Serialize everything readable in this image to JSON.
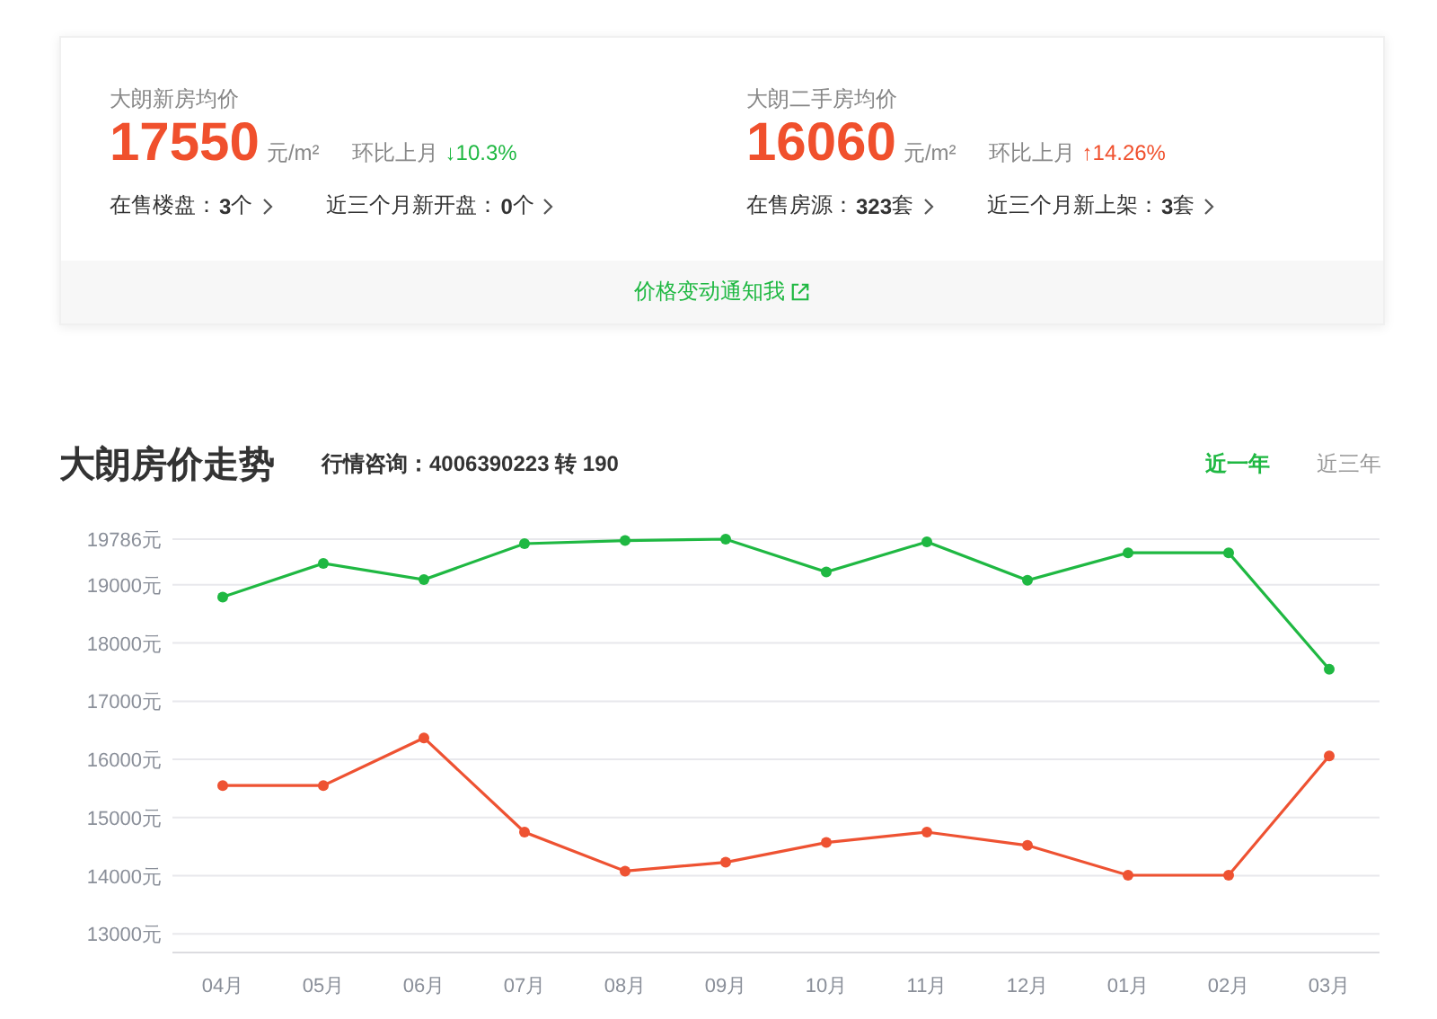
{
  "summary": {
    "cards": [
      {
        "title": "大朗新房均价",
        "price": "17550",
        "unit": "元/m²",
        "change_label": "环比上月",
        "change": "↓10.3%",
        "color": "#1fb842",
        "links": [
          {
            "label": "在售楼盘：",
            "value": "3",
            "suffix": "个"
          },
          {
            "label": "近三个月新开盘：",
            "value": "0",
            "suffix": "个"
          }
        ]
      },
      {
        "title": "大朗二手房均价",
        "price": "16060",
        "unit": "元/m²",
        "change_label": "环比上月",
        "change": "↑14.26%",
        "color": "#f0502d",
        "links": [
          {
            "label": "在售房源：",
            "value": "323",
            "suffix": "套"
          },
          {
            "label": "近三个月新上架：",
            "value": "3",
            "suffix": "套"
          }
        ]
      }
    ],
    "notify_link": "价格变动通知我"
  },
  "trend": {
    "title": "大朗房价走势",
    "hotline": "行情咨询：4006390223 转 190",
    "tabs": [
      {
        "label": "近一年",
        "selected": true
      },
      {
        "label": "近三年",
        "selected": false
      }
    ],
    "chart_data": {
      "type": "line",
      "categories": [
        "04月",
        "05月",
        "06月",
        "07月",
        "08月",
        "09月",
        "10月",
        "11月",
        "12月",
        "01月",
        "02月",
        "03月"
      ],
      "series": [
        {
          "color": "#1fb842",
          "marker": "circle",
          "values": [
            18790,
            19370,
            19090,
            19710,
            19760,
            19786,
            19220,
            19740,
            19080,
            19550,
            19550,
            17550
          ]
        },
        {
          "color": "#ee5232",
          "marker": "circle",
          "values": [
            15550,
            15550,
            16370,
            14750,
            14080,
            14230,
            14570,
            14750,
            14520,
            14010,
            14010,
            16060
          ]
        }
      ],
      "ylim": [
        12680,
        19786
      ],
      "grid": true,
      "yticks": [
        {
          "value": 13000,
          "label": "13000元"
        },
        {
          "value": 14000,
          "label": "14000元"
        },
        {
          "value": 15000,
          "label": "15000元"
        },
        {
          "value": 16000,
          "label": "16000元"
        },
        {
          "value": 17000,
          "label": "17000元"
        },
        {
          "value": 18000,
          "label": "18000元"
        },
        {
          "value": 19000,
          "label": "19000元"
        },
        {
          "value": 19786,
          "label": "19786元"
        }
      ]
    }
  }
}
